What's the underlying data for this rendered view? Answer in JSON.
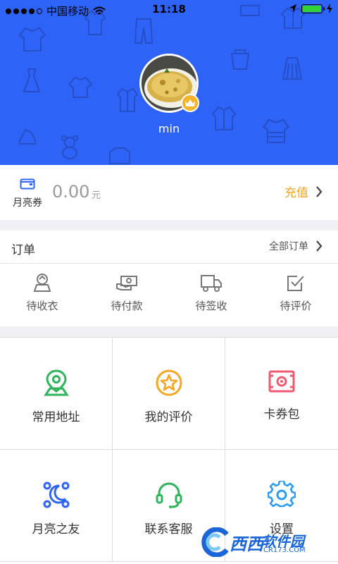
{
  "status_bar": {
    "carrier": "中国移动",
    "time": "11:18"
  },
  "profile": {
    "username": "min"
  },
  "balance": {
    "label": "月亮券",
    "amount": "0.00",
    "unit": "元",
    "recharge_label": "充值"
  },
  "orders": {
    "title": "订单",
    "all_label": "全部订单",
    "items": [
      {
        "label": "待收衣",
        "icon": "collect-clothes-icon"
      },
      {
        "label": "待付款",
        "icon": "payment-icon"
      },
      {
        "label": "待签收",
        "icon": "delivery-truck-icon"
      },
      {
        "label": "待评价",
        "icon": "review-check-icon"
      }
    ]
  },
  "menu": [
    {
      "label": "常用地址",
      "icon": "location-pin-icon",
      "color": "#2db45a"
    },
    {
      "label": "我的评价",
      "icon": "star-icon",
      "color": "#f5a623"
    },
    {
      "label": "卡券包",
      "icon": "coupon-icon",
      "color": "#f05a70"
    },
    {
      "label": "月亮之友",
      "icon": "network-friends-icon",
      "color": "#2d63f7"
    },
    {
      "label": "联系客服",
      "icon": "headset-icon",
      "color": "#2db45a"
    },
    {
      "label": "设置",
      "icon": "gear-icon",
      "color": "#2d9cf0"
    }
  ],
  "watermark": {
    "text": "西西",
    "text2": "软件园",
    "url": "CR173.COM"
  },
  "colors": {
    "header_blue": "#2d63f7",
    "accent_orange": "#f5a623"
  }
}
